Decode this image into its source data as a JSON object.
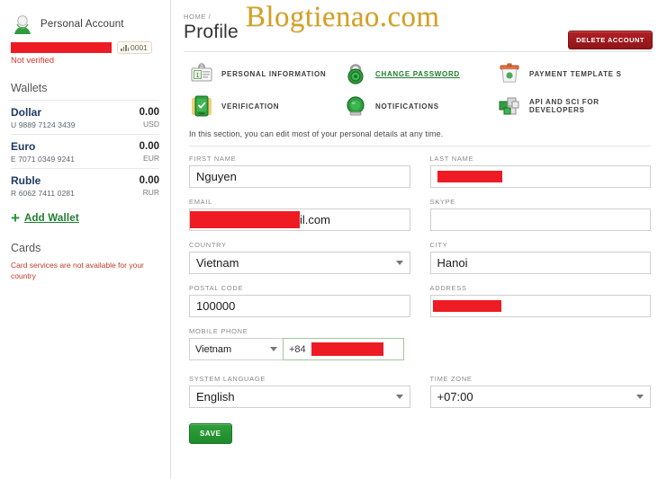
{
  "sidebar": {
    "account": {
      "type_label": "Personal Account",
      "avatar_icon": "user-avatar-icon",
      "email_redacted": true,
      "badge": {
        "icon": "signal-bars-icon",
        "id": "0001"
      },
      "verification_status": "Not verified"
    },
    "wallets_title": "Wallets",
    "wallets": [
      {
        "name": "Dollar",
        "number": "U 9889 7124 3439",
        "amount": "0.00",
        "currency": "USD"
      },
      {
        "name": "Euro",
        "number": "E 7071 0349 9241",
        "amount": "0.00",
        "currency": "EUR"
      },
      {
        "name": "Ruble",
        "number": "R 6062 7411 0281",
        "amount": "0.00",
        "currency": "RUR"
      }
    ],
    "add_wallet_label": "Add Wallet",
    "cards_title": "Cards",
    "cards_note": "Card services are not available for your country"
  },
  "header": {
    "breadcrumb": "HOME /",
    "title": "Profile",
    "watermark": "Blogtienao.com",
    "delete_button": "DELETE ACCOUNT"
  },
  "menu": [
    {
      "label": "PERSONAL INFORMATION",
      "icon": "id-card-icon",
      "link": false
    },
    {
      "label": "CHANGE PASSWORD",
      "icon": "padlock-icon",
      "link": true
    },
    {
      "label": "PAYMENT TEMPLATE S",
      "icon": "payment-template-icon",
      "link": false
    },
    {
      "label": "VERIFICATION",
      "icon": "mobile-verification-icon",
      "link": false
    },
    {
      "label": "NOTIFICATIONS",
      "icon": "bell-icon",
      "link": false
    },
    {
      "label": "API AND SCI FOR DEVELOPERS",
      "icon": "api-cubes-icon",
      "link": false
    }
  ],
  "section_note": "In this section, you can edit most of your personal details at any time.",
  "form": {
    "first_name": {
      "label": "FIRST NAME",
      "value": "Nguyen"
    },
    "last_name": {
      "label": "LAST NAME",
      "value": "",
      "redacted": true
    },
    "email": {
      "label": "EMAIL",
      "value": "il.com",
      "redacted": true
    },
    "skype": {
      "label": "SKYPE",
      "value": ""
    },
    "country": {
      "label": "COUNTRY",
      "value": "Vietnam"
    },
    "city": {
      "label": "CITY",
      "value": "Hanoi"
    },
    "postal_code": {
      "label": "POSTAL CODE",
      "value": "100000"
    },
    "address": {
      "label": "ADDRESS",
      "value": "",
      "redacted": true
    },
    "mobile_phone": {
      "label": "MOBILE PHONE",
      "country": "Vietnam",
      "dial_code": "+84",
      "number_redacted": true
    },
    "system_language": {
      "label": "SYSTEM LANGUAGE",
      "value": "English"
    },
    "time_zone": {
      "label": "TIME ZONE",
      "value": "+07:00"
    },
    "save_label": "SAVE"
  },
  "colors": {
    "redaction": "#ee1b24",
    "green": "#1e8a2b",
    "delete_red": "#a41d22",
    "watermark_gold": "#d5a021"
  }
}
